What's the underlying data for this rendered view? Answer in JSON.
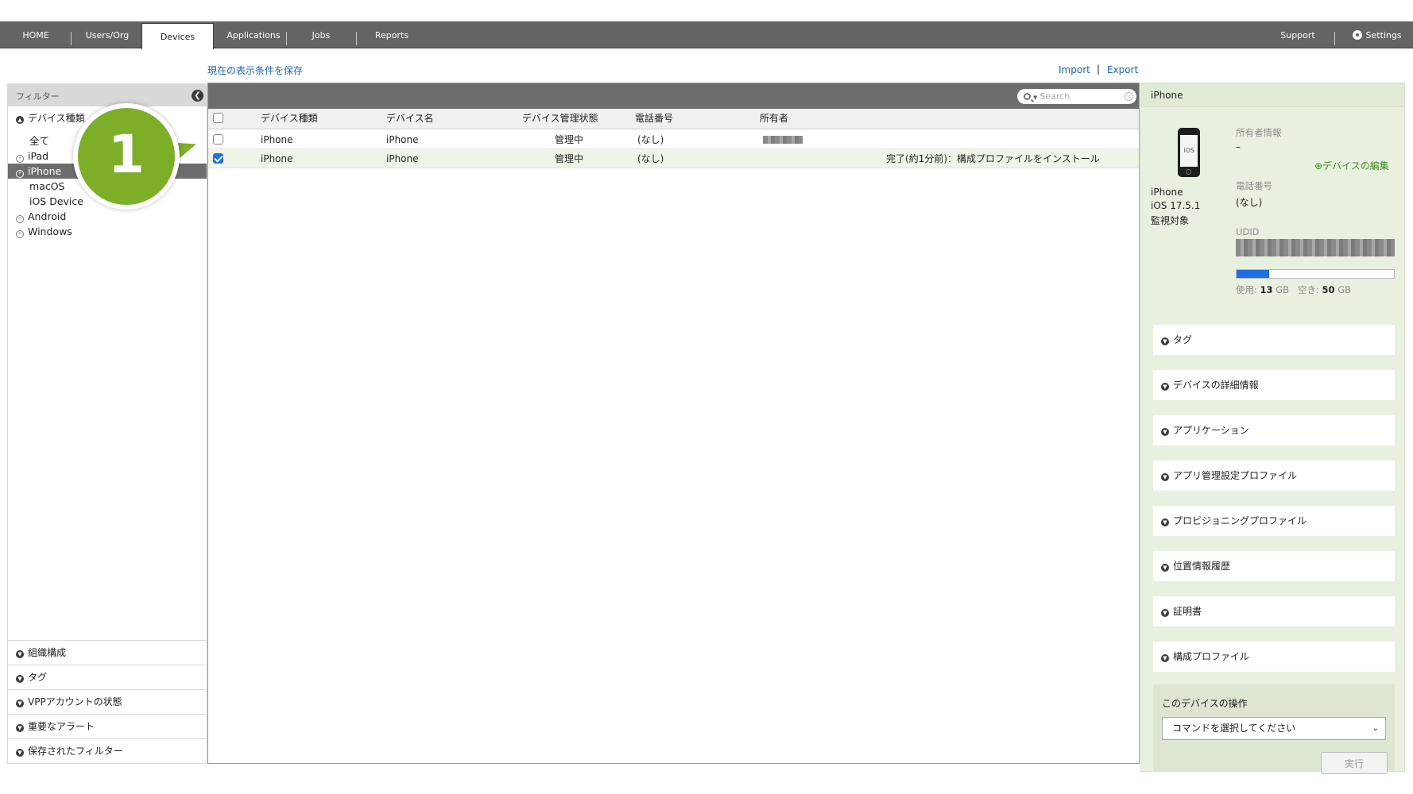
{
  "nav": {
    "tabs": [
      {
        "label": "HOME"
      },
      {
        "label": "Users/Org"
      },
      {
        "label": "Devices",
        "active": true
      },
      {
        "label": "Applications"
      },
      {
        "label": "Jobs"
      },
      {
        "label": "Reports"
      }
    ],
    "support_label": "Support",
    "settings_label": "Settings"
  },
  "toolbar": {
    "save_view_label": "現在の表示条件を保存",
    "import_label": "Import",
    "separator": "|",
    "export_label": "Export"
  },
  "filter": {
    "header": "フィルター",
    "device_type_label": "デバイス種類",
    "items": [
      {
        "label": "全て"
      },
      {
        "label": "iPad"
      },
      {
        "label": "iPhone",
        "selected": true
      },
      {
        "label": "macOS"
      },
      {
        "label": "iOS Device"
      },
      {
        "label": "Android"
      },
      {
        "label": "Windows"
      }
    ],
    "sections": [
      {
        "label": "組織構成"
      },
      {
        "label": "タグ"
      },
      {
        "label": "VPPアカウントの状態"
      },
      {
        "label": "重要なアラート"
      },
      {
        "label": "保存されたフィルター"
      }
    ]
  },
  "table": {
    "search_placeholder": "Search",
    "columns": [
      "デバイス種類",
      "デバイス名",
      "デバイス管理状態",
      "電話番号",
      "所有者"
    ],
    "rows": [
      {
        "type": "iPhone",
        "name": "iPhone",
        "status": "管理中",
        "phone": "(なし)",
        "note": "",
        "checked": false
      },
      {
        "type": "iPhone",
        "name": "iPhone",
        "status": "管理中",
        "phone": "(なし)",
        "note": "完了(約1分前)：構成プロファイルをインストール",
        "checked": true
      }
    ]
  },
  "callout": {
    "number": "1",
    "color": "#7dae28"
  },
  "detail": {
    "title": "iPhone",
    "icon_text": "iOS",
    "device_name": "iPhone",
    "os_version": "iOS 17.5.1",
    "supervised": "監視対象",
    "owner_label": "所有者情報",
    "owner_value": "–",
    "edit_link": "デバイスの編集",
    "phone_label": "電話番号",
    "phone_value": "(なし)",
    "udid_label": "UDID",
    "storage_used_label": "使用:",
    "storage_used_value": "13",
    "storage_free_label": "空き:",
    "storage_free_value": "50",
    "storage_unit": "GB",
    "storage_used_fraction": 0.206,
    "sections": [
      {
        "label": "タグ"
      },
      {
        "label": "デバイスの詳細情報"
      },
      {
        "label": "アプリケーション"
      },
      {
        "label": "アプリ管理設定プロファイル"
      },
      {
        "label": "プロビジョニングプロファイル"
      },
      {
        "label": "位置情報履歴"
      },
      {
        "label": "証明書"
      },
      {
        "label": "構成プロファイル"
      }
    ],
    "ops_title": "このデバイスの操作",
    "ops_select": "コマンドを選択してください",
    "run_label": "実行"
  },
  "colors": {
    "nav_bg": "#646464",
    "accent_green": "#7dae28",
    "link_blue": "#1a64b0",
    "detail_bg": "#e8f1df",
    "checkbox_blue": "#1f6fe0"
  }
}
